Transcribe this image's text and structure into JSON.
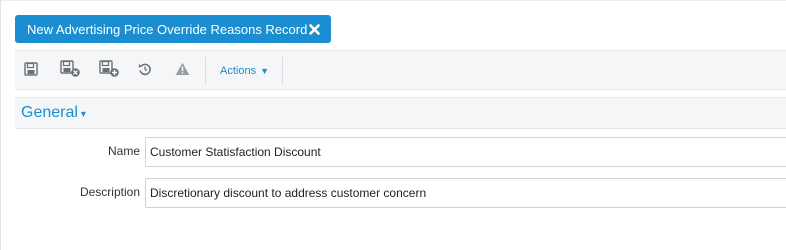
{
  "tab": {
    "title": "New Advertising Price Override Reasons Record",
    "close_icon": "close-icon"
  },
  "toolbar": {
    "buttons": [
      {
        "name": "save",
        "icon": "save-icon"
      },
      {
        "name": "save-and-close",
        "icon": "save-close-icon"
      },
      {
        "name": "save-and-new",
        "icon": "save-new-icon"
      },
      {
        "name": "undo",
        "icon": "undo-icon"
      },
      {
        "name": "warnings",
        "icon": "warning-icon"
      }
    ],
    "actions_label": "Actions",
    "actions_caret": "▼"
  },
  "section": {
    "title": "General",
    "caret": "▾"
  },
  "form": {
    "name_label": "Name",
    "name_value": "Customer Statisfaction Discount",
    "description_label": "Description",
    "description_value": "Discretionary discount to address customer concern"
  },
  "colors": {
    "accent": "#1a8ed0",
    "toolbar_bg": "#f5f6f7",
    "icon_gray": "#6b7075"
  }
}
